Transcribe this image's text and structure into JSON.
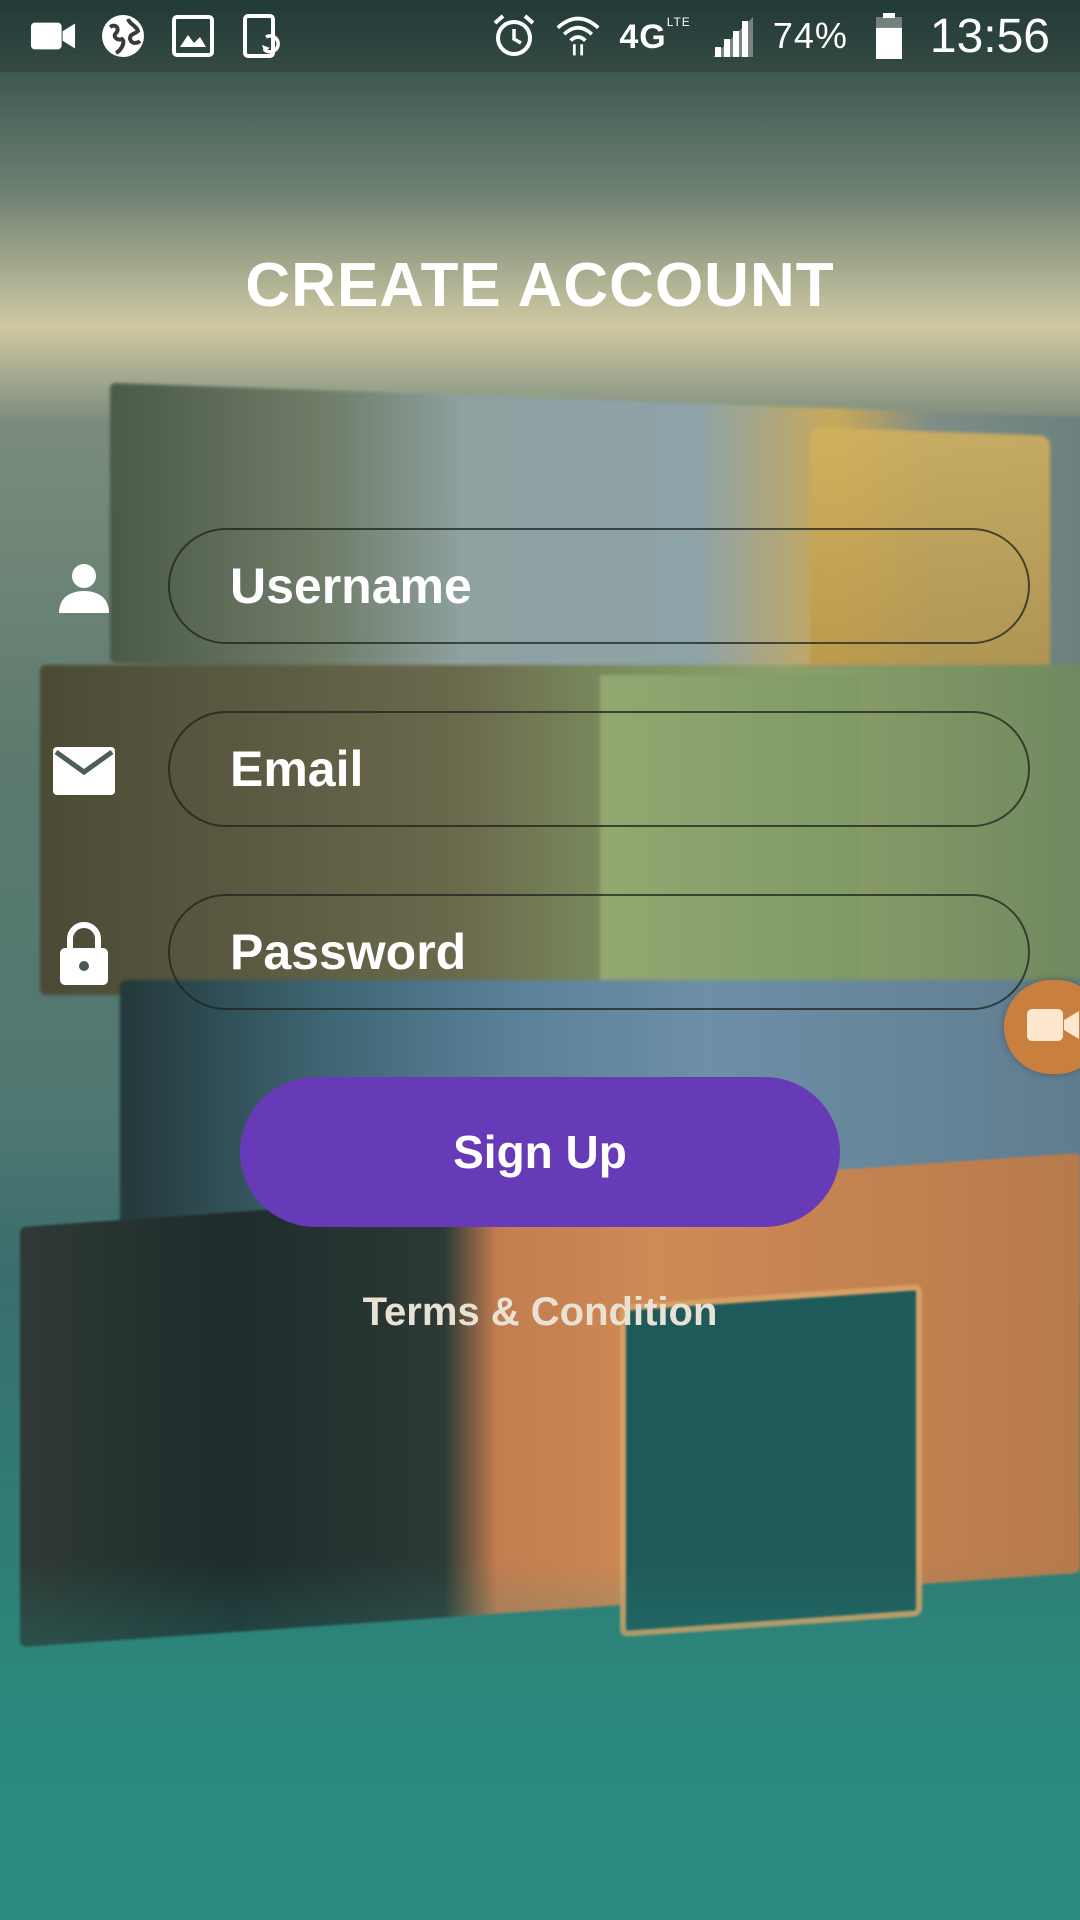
{
  "status_bar": {
    "left_icons": [
      "video-camera-icon",
      "globe-icon",
      "image-icon",
      "screen-rotate-icon"
    ],
    "right_icons": [
      "alarm-icon",
      "wifi-icon",
      "signal-icon",
      "battery-icon"
    ],
    "network": "4G",
    "network_sub": "LTE",
    "battery_percent": "74%",
    "battery_level": 0.74,
    "time": "13:56"
  },
  "page": {
    "title": "CREATE ACCOUNT"
  },
  "form": {
    "username": {
      "placeholder": "Username",
      "value": "",
      "icon": "person-icon"
    },
    "email": {
      "placeholder": "Email",
      "value": "",
      "icon": "mail-icon"
    },
    "password": {
      "placeholder": "Password",
      "value": "",
      "icon": "lock-icon"
    },
    "signup_label": "Sign Up",
    "terms_label": "Terms & Condition"
  },
  "overlay": {
    "floating_button_icon": "video-camera-icon"
  },
  "colors": {
    "accent": "#673ab7",
    "text": "#ffffff",
    "recorder_bubble": "#c9803e"
  }
}
